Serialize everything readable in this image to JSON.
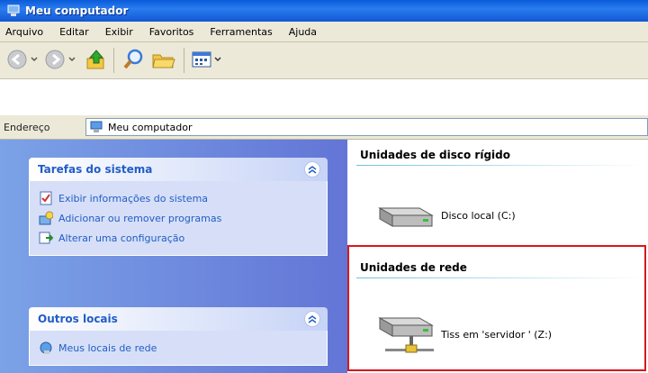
{
  "window": {
    "title": "Meu computador"
  },
  "menu": [
    "Arquivo",
    "Editar",
    "Exibir",
    "Favoritos",
    "Ferramentas",
    "Ajuda"
  ],
  "address": {
    "label": "Endereço",
    "value": "Meu computador"
  },
  "panels": {
    "system_tasks": {
      "title": "Tarefas do sistema",
      "items": [
        "Exibir informações do sistema",
        "Adicionar ou remover programas",
        "Alterar uma configuração"
      ]
    },
    "other_places": {
      "title": "Outros locais",
      "items": [
        "Meus locais de rede"
      ]
    }
  },
  "groups": {
    "hard_disks": {
      "title": "Unidades de disco rígido",
      "items": [
        "Disco local (C:)"
      ]
    },
    "network": {
      "title": "Unidades de rede",
      "items": [
        "Tiss em 'servidor ' (Z:)"
      ]
    }
  },
  "colors": {
    "title_bar": "#1258d3",
    "panel_text": "#215dc6",
    "highlight_box": "#d9161c"
  }
}
